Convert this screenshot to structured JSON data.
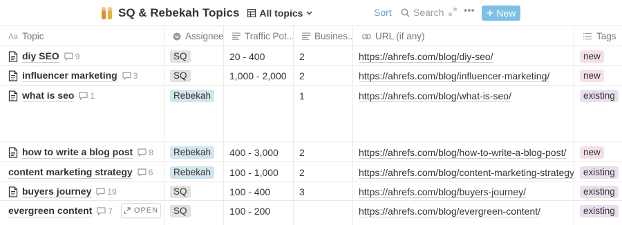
{
  "header": {
    "title": "SQ & Rebekah Topics",
    "title_emoji": "people-holding-hands-emoji",
    "view_label": "All topics",
    "sort_label": "Sort",
    "search_label": "Search",
    "new_label": "New"
  },
  "columns": [
    {
      "label": "Topic",
      "icon": "text-icon"
    },
    {
      "label": "Assignee",
      "icon": "select-icon"
    },
    {
      "label": "Traffic Pot...",
      "icon": "text-lines-icon"
    },
    {
      "label": "Busines...",
      "icon": "text-lines-icon"
    },
    {
      "label": "URL (if any)",
      "icon": "link-icon"
    },
    {
      "label": "Tags",
      "icon": "list-icon"
    }
  ],
  "rows": [
    {
      "topic": "diy SEO",
      "comments": "9",
      "has_icon": true,
      "assignee": "SQ",
      "traffic": "20 - 400",
      "business": "2",
      "url": "https://ahrefs.com/blog/diy-seo/",
      "tag": "new"
    },
    {
      "topic": "influencer marketing",
      "comments": "3",
      "has_icon": true,
      "assignee": "SQ",
      "traffic": "1,000 - 2,000",
      "business": "2",
      "url": "https://ahrefs.com/blog/influencer-marketing/",
      "tag": "new"
    },
    {
      "topic": "what is seo",
      "comments": "1",
      "has_icon": true,
      "assignee": "Rebekah",
      "traffic": "",
      "business": "1",
      "url": "https://ahrefs.com/blog/what-is-seo/",
      "tag": "existing"
    },
    {
      "topic": "how to write a blog post",
      "comments": "8",
      "has_icon": true,
      "assignee": "Rebekah",
      "traffic": "400 - 3,000",
      "business": "2",
      "url": "https://ahrefs.com/blog/how-to-write-a-blog-post/",
      "tag": "new"
    },
    {
      "topic": "content marketing strategy",
      "comments": "6",
      "has_icon": false,
      "assignee": "Rebekah",
      "traffic": "100 - 1,000",
      "business": "2",
      "url": "https://ahrefs.com/blog/content-marketing-strategy/",
      "tag": "existing"
    },
    {
      "topic": "buyers journey",
      "comments": "19",
      "has_icon": true,
      "assignee": "SQ",
      "traffic": "100 - 400",
      "business": "3",
      "url": "https://ahrefs.com/blog/buyers-journey/",
      "tag": "existing"
    },
    {
      "topic": "evergreen content",
      "comments": "7",
      "has_icon": false,
      "assignee": "SQ",
      "traffic": "100 - 200",
      "business": "",
      "url": "https://ahrefs.com/blog/evergreen-content/",
      "tag": "existing",
      "open_label": "OPEN"
    }
  ],
  "colors": {
    "sq": "#e3e2e0",
    "rebekah": "#d3e5ef",
    "new": "#f5e0e9",
    "existing": "#e8deee",
    "accent": "#5a9fd6",
    "new_button": "#7ebfe6"
  }
}
